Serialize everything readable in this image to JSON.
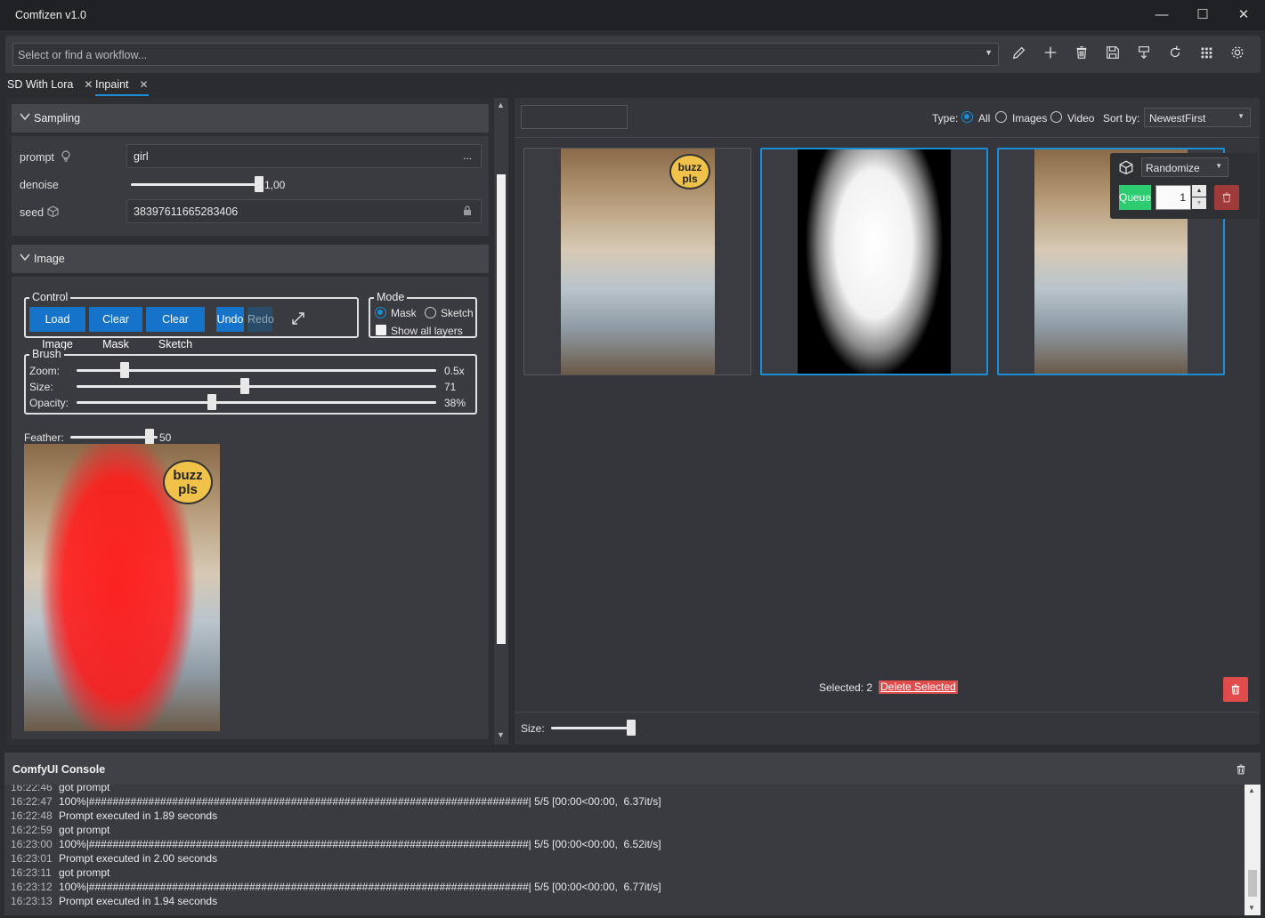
{
  "window": {
    "title": "Comfizen v1.0"
  },
  "toolbar": {
    "workflow_placeholder": "Select or find a workflow..."
  },
  "tabs": [
    {
      "label": "SD With Lora",
      "close": "✕"
    },
    {
      "label": "Inpaint",
      "close": "✕"
    }
  ],
  "sampling": {
    "title": "Sampling",
    "prompt_label": "prompt",
    "prompt_value": "girl",
    "prompt_more": "...",
    "denoise_label": "denoise",
    "denoise_value": "1,00",
    "denoise_fraction": 1.0,
    "seed_label": "seed",
    "seed_value": "383976116652834​06"
  },
  "image": {
    "title": "Image",
    "control_title": "Control",
    "buttons": {
      "load": "Load Image",
      "clear_mask": "Clear Mask",
      "clear_sketch": "Clear Sketch",
      "undo": "Undo",
      "redo": "Redo"
    },
    "mode_title": "Mode",
    "mode_mask": "Mask",
    "mode_sketch": "Sketch",
    "show_all_layers": "Show all layers",
    "brush_title": "Brush",
    "zoom_label": "Zoom:",
    "zoom_value": "0.5x",
    "zoom_fraction": 0.14,
    "size_label": "Size:",
    "size_value": "71",
    "size_fraction": 0.47,
    "opacity_label": "Opacity:",
    "opacity_value": "38%",
    "opacity_fraction": 0.38,
    "feather_label": "Feather:",
    "feather_value": "50",
    "feather_fraction": 1.0,
    "canvas_bubble": "buzz\npls"
  },
  "gallery": {
    "type_label": "Type:",
    "type_all": "All",
    "type_images": "Images",
    "type_video": "Video",
    "sort_label": "Sort by:",
    "sort_value": "NewestFirst",
    "bubble": "buzz\npls",
    "selected_text": "Selected: 2",
    "delete_selected": "Delete Selected",
    "size_label": "Size:",
    "size_fraction": 0.9
  },
  "queue_popup": {
    "seed_mode": "Randomize",
    "queue_label": "Queue",
    "count": "1"
  },
  "console": {
    "title": "ComfyUI Console",
    "lines": [
      {
        "ts": "16:22:46",
        "msg": "got prompt"
      },
      {
        "ts": "16:22:47",
        "msg": "100%|##########################################################################| 5/5 [00:00<00:00,  6.37it/s]"
      },
      {
        "ts": "16:22:48",
        "msg": "Prompt executed in 1.89 seconds"
      },
      {
        "ts": "16:22:59",
        "msg": "got prompt"
      },
      {
        "ts": "16:23:00",
        "msg": "100%|##########################################################################| 5/5 [00:00<00:00,  6.52it/s]"
      },
      {
        "ts": "16:23:01",
        "msg": "Prompt executed in 2.00 seconds"
      },
      {
        "ts": "16:23:11",
        "msg": "got prompt"
      },
      {
        "ts": "16:23:12",
        "msg": "100%|##########################################################################| 5/5 [00:00<00:00,  6.77it/s]"
      },
      {
        "ts": "16:23:13",
        "msg": "Prompt executed in 1.94 seconds"
      }
    ]
  },
  "colors": {
    "accent": "#1a8fd8",
    "button_blue": "#1574c9",
    "queue_green": "#2ecc71",
    "delete_red": "#e04b4b"
  }
}
